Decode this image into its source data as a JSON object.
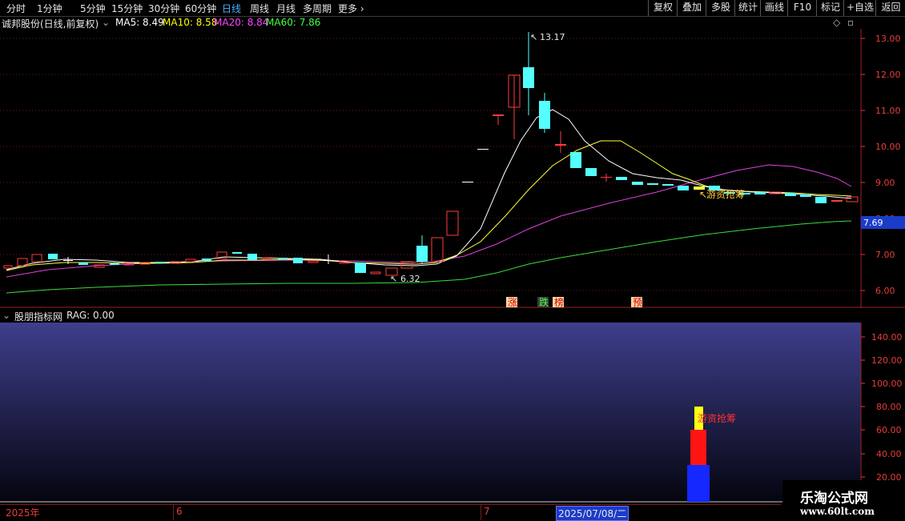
{
  "toolbar": {
    "periods": [
      {
        "label": "分时",
        "active": false
      },
      {
        "label": "1分钟",
        "active": false
      },
      {
        "label": "5分钟",
        "active": false
      },
      {
        "label": "15分钟",
        "active": false
      },
      {
        "label": "30分钟",
        "active": false
      },
      {
        "label": "60分钟",
        "active": false
      },
      {
        "label": "日线",
        "active": true
      },
      {
        "label": "周线",
        "active": false
      },
      {
        "label": "月线",
        "active": false
      },
      {
        "label": "多周期",
        "active": false
      },
      {
        "label": "更多",
        "active": false
      }
    ],
    "right_buttons": [
      "复权",
      "叠加",
      "多股",
      "统计",
      "画线",
      "F10",
      "标记",
      "+自选",
      "返回"
    ]
  },
  "main_panel": {
    "title": "诚邦股份(日线,前复权)",
    "ma": [
      {
        "label": "MA5: 8.49",
        "color": "#ffffff"
      },
      {
        "label": "MA10: 8.58",
        "color": "#ffff00"
      },
      {
        "label": "MA20: 8.84",
        "color": "#ff44ff"
      },
      {
        "label": "MA60: 7.86",
        "color": "#44ff44"
      }
    ],
    "high_label": "13.17",
    "low_label": "6.32",
    "current_price": "7.69",
    "annotation": "游资抢筹",
    "signals": [
      {
        "text": "涨",
        "bg": "#ffd6a0",
        "color": "#cc0000"
      },
      {
        "text": "跌",
        "bg": "#3c3c3c",
        "color": "#44ff44"
      },
      {
        "text": "榜",
        "bg": "#ffd6a0",
        "color": "#cc0000"
      },
      {
        "text": "预",
        "bg": "#ffd6a0",
        "color": "#cc0000"
      }
    ],
    "y_ticks": [
      "13.00",
      "12.00",
      "11.00",
      "10.00",
      "9.00",
      "8.00",
      "7.00",
      "6.00"
    ]
  },
  "sub_panel": {
    "title": "股朋指标网",
    "value": "RAG: 0.00",
    "annotation": "游资抢筹",
    "y_ticks": [
      "140.00",
      "120.00",
      "100.00",
      "80.00",
      "60.00",
      "40.00",
      "20.00"
    ]
  },
  "bottom_bar": {
    "year": "2025年",
    "months": [
      "6",
      "7"
    ],
    "cursor_date": "2025/07/08/二"
  },
  "watermark": {
    "name": "乐淘公式网",
    "url": "www.60lt.com"
  },
  "colors": {
    "up": "#ff3c3c",
    "down": "#54ffff",
    "axis": "#e83c3c"
  }
}
